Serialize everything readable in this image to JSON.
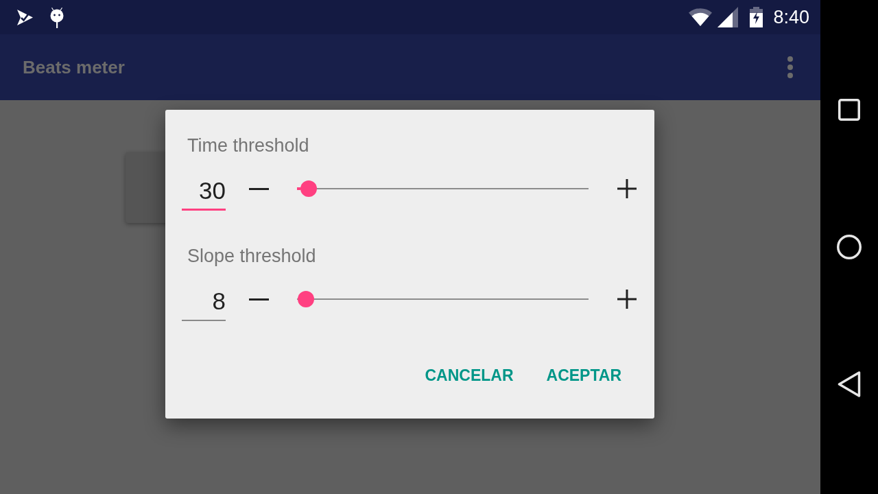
{
  "status_bar": {
    "time": "8:40"
  },
  "app_bar": {
    "title": "Beats meter"
  },
  "dialog": {
    "settings": [
      {
        "label": "Time threshold",
        "value": "30",
        "focused": true,
        "level": 0.04
      },
      {
        "label": "Slope threshold",
        "value": "8",
        "focused": false,
        "level": 0.03
      }
    ],
    "buttons": [
      "CANCELAR",
      "ACEPTAR"
    ]
  }
}
